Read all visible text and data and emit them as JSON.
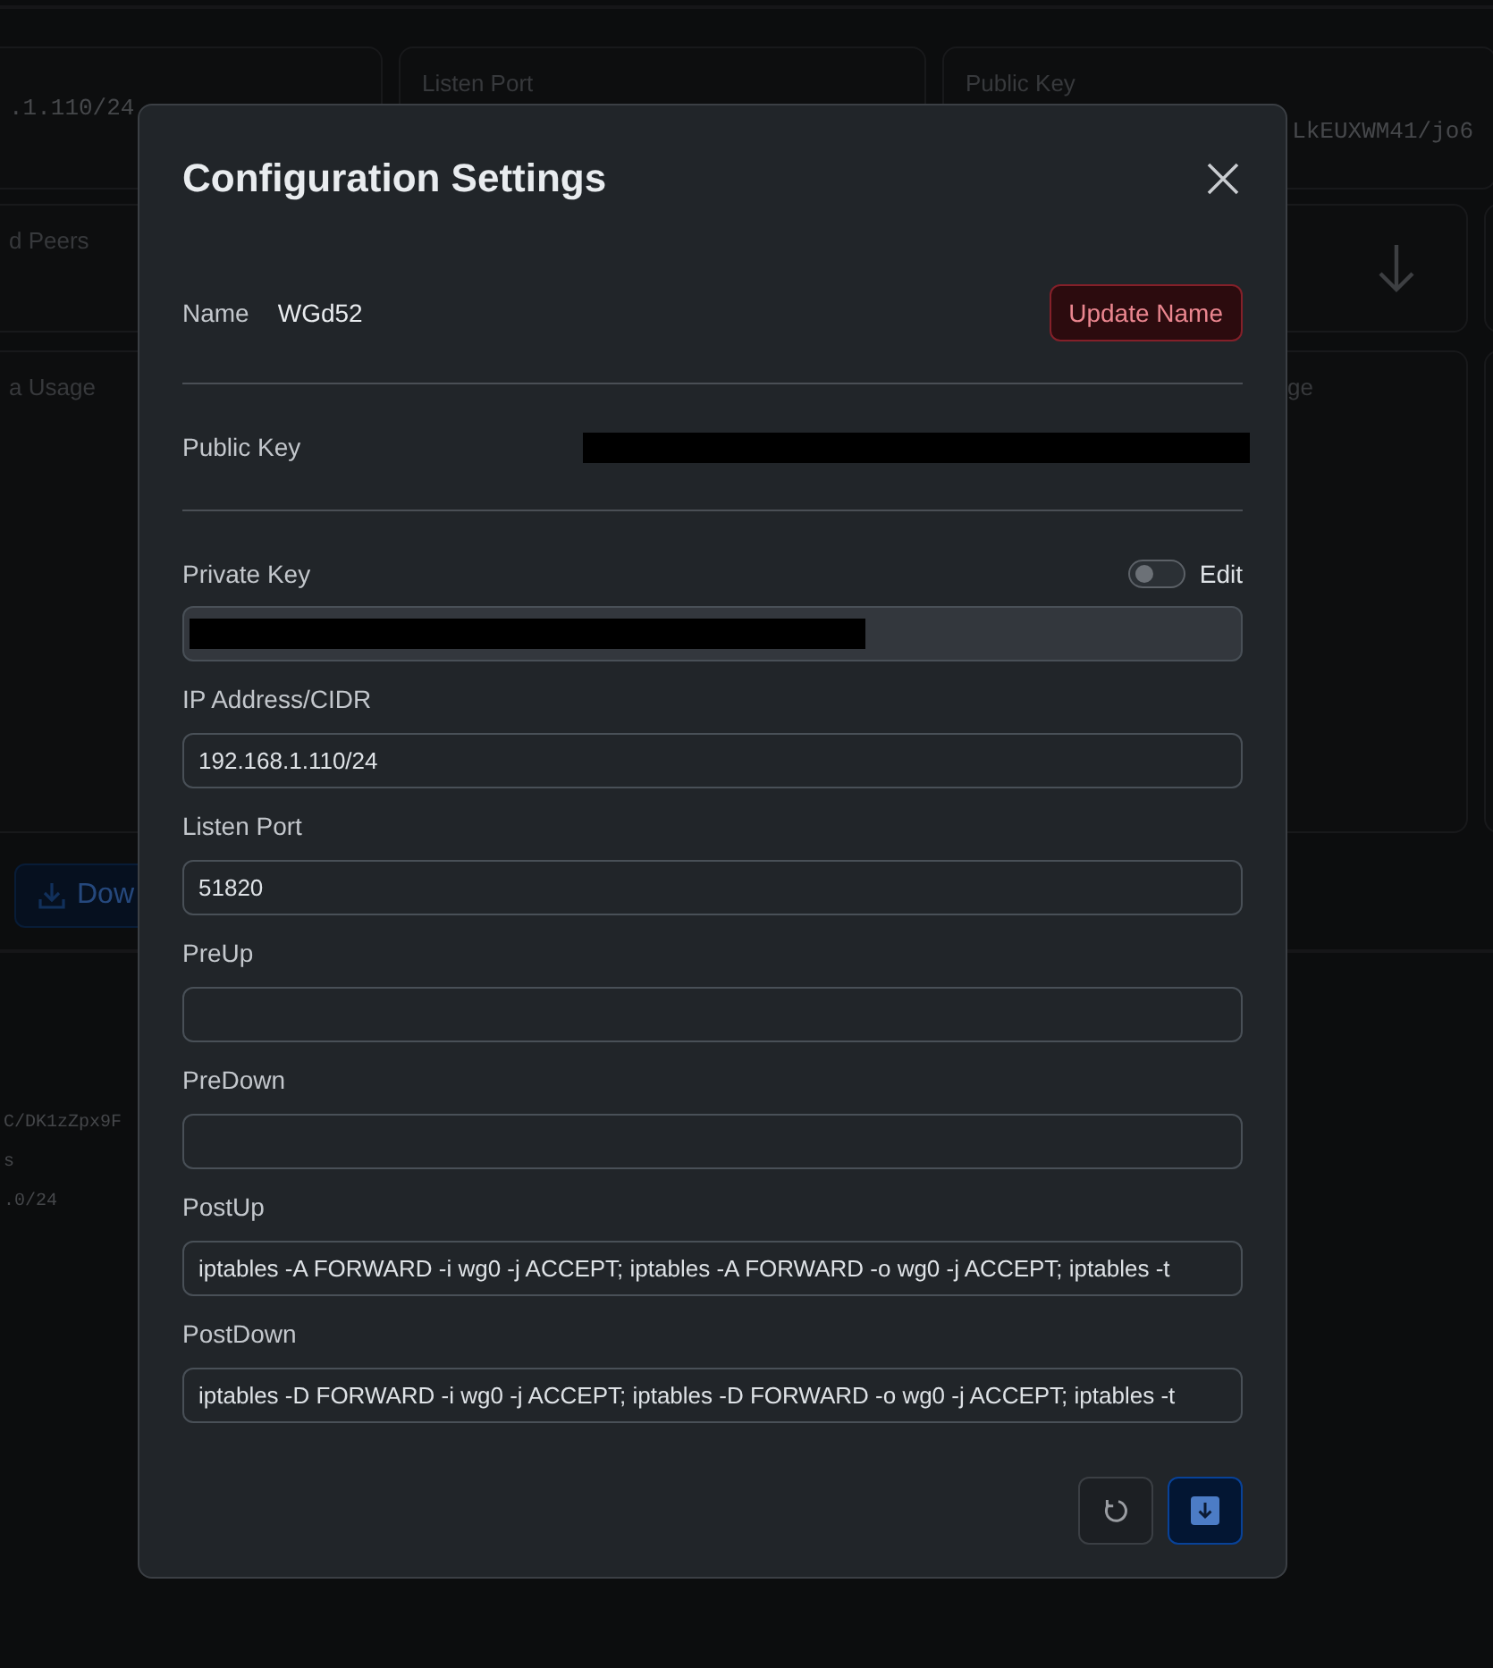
{
  "background": {
    "row_1": [
      {
        "kind": "value",
        "text": ".1.110/24"
      },
      {
        "kind": "label",
        "text": "Listen Port"
      },
      {
        "kind": "label_value",
        "text": "Public Key",
        "value": "LkEUXWM41/jo6"
      }
    ],
    "row_2": [
      {
        "kind": "label",
        "text": "d Peers"
      },
      {
        "kind": "blank"
      },
      {
        "kind": "arrow"
      },
      {
        "kind": "blank"
      }
    ],
    "row_3": [
      {
        "kind": "label",
        "text": "a Usage"
      },
      {
        "kind": "label",
        "text": "ge"
      },
      {
        "kind": "blank"
      }
    ],
    "download_button": "Dow",
    "peer_lines": [
      "C/DK1zZpx9F",
      "s",
      ".0/24"
    ]
  },
  "modal": {
    "title": "Configuration Settings",
    "name": {
      "label": "Name",
      "value": "WGd52",
      "button": "Update Name"
    },
    "public_key": {
      "label": "Public Key",
      "redacted": true
    },
    "private_key": {
      "label": "Private Key",
      "toggle_label": "Edit",
      "on": false,
      "disabled": true,
      "redacted": true
    },
    "fields": [
      {
        "label": "IP Address/CIDR",
        "value": "192.168.1.110/24"
      },
      {
        "label": "Listen Port",
        "value": "51820"
      },
      {
        "label": "PreUp"
      },
      {
        "label": "PreDown"
      },
      {
        "label": "PostUp",
        "value": "iptables -A FORWARD -i wg0 -j ACCEPT; iptables -A FORWARD -o wg0 -j ACCEPT; iptables -t"
      },
      {
        "label": "PostDown",
        "value": "iptables -D FORWARD -i wg0 -j ACCEPT; iptables -D FORWARD -o wg0 -j ACCEPT; iptables -t"
      }
    ]
  }
}
